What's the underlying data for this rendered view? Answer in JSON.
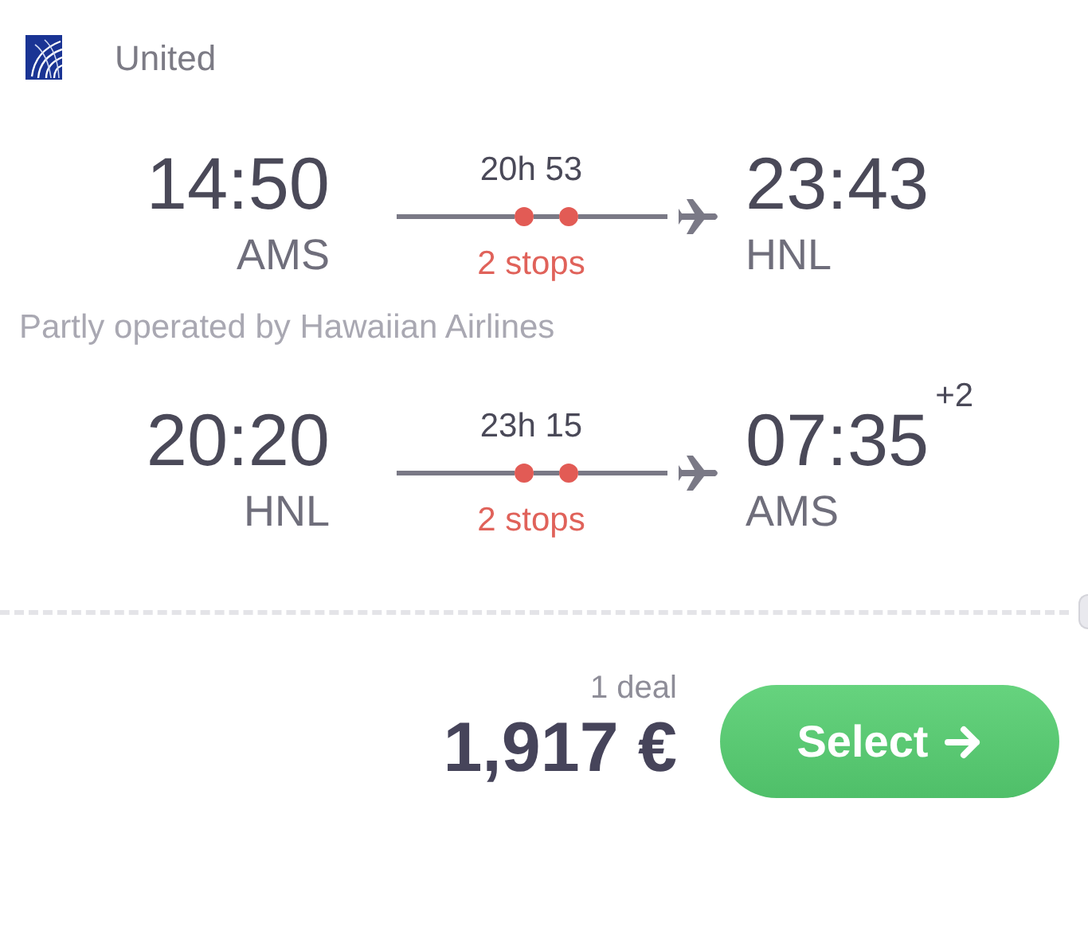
{
  "airline": {
    "name": "United"
  },
  "legs": [
    {
      "departure": {
        "time": "14:50",
        "airport": "AMS"
      },
      "duration": "20h 53",
      "stops": "2 stops",
      "arrival": {
        "time": "23:43",
        "airport": "HNL"
      },
      "note": "Partly operated by Hawaiian Airlines"
    },
    {
      "departure": {
        "time": "20:20",
        "airport": "HNL"
      },
      "duration": "23h 15",
      "stops": "2 stops",
      "arrival": {
        "time": "07:35",
        "airport": "AMS",
        "day_offset": "+2"
      }
    }
  ],
  "price": {
    "deals": "1 deal",
    "amount": "1,917 €"
  },
  "select_button": {
    "label": "Select"
  }
}
